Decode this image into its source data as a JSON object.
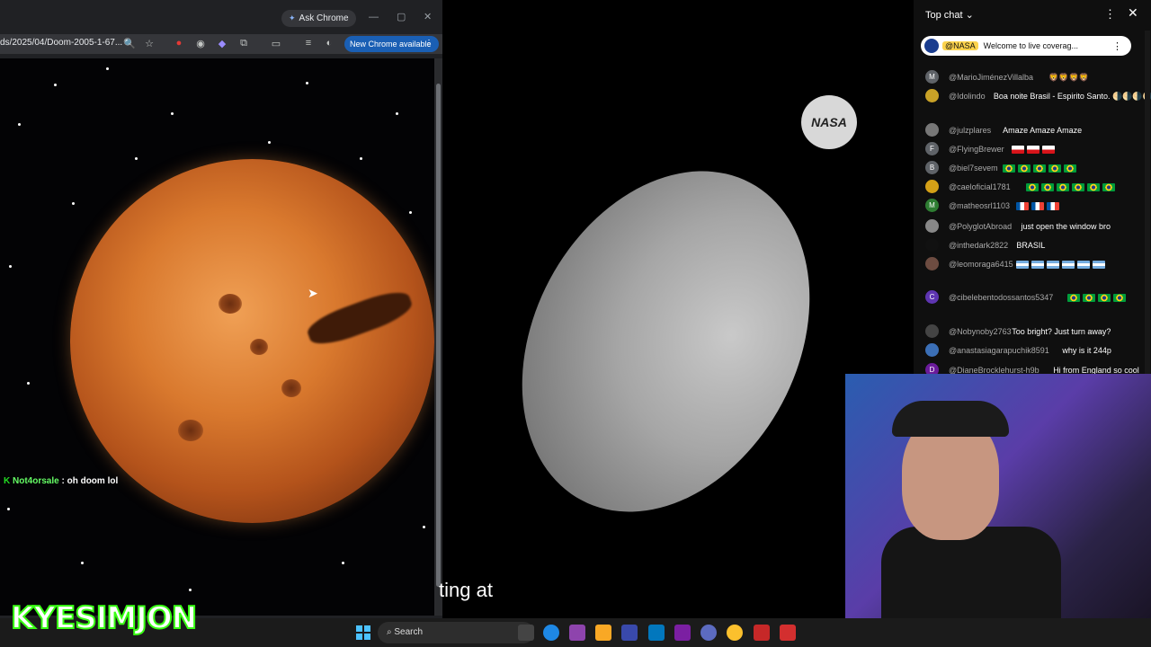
{
  "chrome": {
    "ask_chrome_label": "Ask Chrome",
    "url": "ds/2025/04/Doom-2005-1-67...",
    "new_chrome_label": "New Chrome available"
  },
  "stream_overlay": {
    "username": "Not4orsale",
    "message": ": oh doom lol",
    "caption": "ting at",
    "channel_watermark": "YESIMJON",
    "watermark_prefix": "K"
  },
  "youtube_chat": {
    "title": "Top chat",
    "pinned": {
      "user": "@NASA",
      "text": "Welcome to live coverag..."
    },
    "messages": [
      {
        "user": "@MarioJiménezVillalba",
        "text": "",
        "emoji": "🦁🦁🦁🦁",
        "avatar": "M",
        "avatar_color": "#5f6368"
      },
      {
        "user": "@Idolindo",
        "text": "Boa noite Brasil - Espirito Santo.",
        "emoji": "🌗🌗🌗🌗",
        "avatar": "",
        "avatar_color": "#c9a227"
      },
      {
        "user": "@julzplares",
        "text": "Amaze Amaze Amaze",
        "emoji": "",
        "avatar": "",
        "avatar_color": "#777"
      },
      {
        "user": "@FlyingBrewer",
        "text": "",
        "emoji": "",
        "avatar": "F",
        "avatar_color": "#5f6368",
        "flags": "cz"
      },
      {
        "user": "@biel7sevem",
        "text": "",
        "emoji": "",
        "avatar": "B",
        "avatar_color": "#5f6368",
        "flags": "br5"
      },
      {
        "user": "@caeloficial1781",
        "text": "",
        "emoji": "",
        "avatar": "",
        "avatar_color": "#d4a017",
        "flags": "br6"
      },
      {
        "user": "@matheosrl1103",
        "text": "",
        "emoji": "",
        "avatar": "M",
        "avatar_color": "#2e7d32",
        "flags": "fr"
      },
      {
        "user": "@PolyglotAbroad",
        "text": "just open the window bro",
        "emoji": "",
        "avatar": "",
        "avatar_color": "#888"
      },
      {
        "user": "@inthedark2822",
        "text": "BRASIL",
        "emoji": "",
        "avatar": "",
        "avatar_color": "#111"
      },
      {
        "user": "@leomoraga6415",
        "text": "",
        "emoji": "",
        "avatar": "",
        "avatar_color": "#6d4c41",
        "flags": "ar"
      },
      {
        "user": "@cibelebentodossantos5347",
        "text": "",
        "emoji": "",
        "avatar": "C",
        "avatar_color": "#5e35b1",
        "flags": "br4"
      },
      {
        "user": "@Nobynoby2763",
        "text": "Too bright? Just turn away?",
        "emoji": "",
        "avatar": "",
        "avatar_color": "#444"
      },
      {
        "user": "@anastasiagarapuchik8591",
        "text": "why is it 244p",
        "emoji": "",
        "avatar": "",
        "avatar_color": "#3b6fb6"
      },
      {
        "user": "@DianeBrocklehurst-h9b",
        "text": "Hi from England so cool",
        "emoji": "",
        "avatar": "D",
        "avatar_color": "#6a1b9a"
      }
    ]
  },
  "taskbar": {
    "search_placeholder": "Search"
  },
  "colors": {
    "chrome_bg": "#202124",
    "chat_bg": "#0f0f0f",
    "accent_blue": "#1a5fb4",
    "overlay_green": "#66ff66"
  }
}
